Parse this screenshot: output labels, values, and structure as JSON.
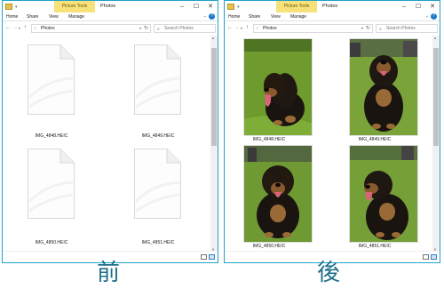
{
  "windows": {
    "left": {
      "title": "Photos",
      "context_tab": "Picture Tools",
      "ribbon_tabs": [
        "Home",
        "Share",
        "View",
        "Manage"
      ],
      "breadcrumb": "Photos",
      "search_placeholder": "Search Photos",
      "files": [
        {
          "name": "IMG_4848.HEIC"
        },
        {
          "name": "IMG_4849.HEIC"
        },
        {
          "name": "IMG_4850.HEIC"
        },
        {
          "name": "IMG_4851.HEIC"
        }
      ]
    },
    "right": {
      "title": "Photos",
      "context_tab": "Picture Tools",
      "ribbon_tabs": [
        "Home",
        "Share",
        "View",
        "Manage"
      ],
      "breadcrumb": "Photos",
      "search_placeholder": "Search Photos",
      "files": [
        {
          "name": "IMG_4848.HEIC"
        },
        {
          "name": "IMG_4849.HEIC"
        },
        {
          "name": "IMG_4850.HEIC"
        },
        {
          "name": "IMG_4851.HEIC"
        }
      ]
    }
  },
  "captions": {
    "before": "前",
    "after": "後"
  },
  "icons": {
    "back": "back-arrow-icon",
    "forward": "forward-arrow-icon",
    "up": "up-arrow-icon",
    "refresh": "refresh-icon",
    "search": "search-icon",
    "minimize": "minimize-icon",
    "maximize": "maximize-icon",
    "close": "close-icon",
    "help": "help-icon"
  },
  "colors": {
    "accent": "#1fa2c9",
    "context_tab": "#f7e17a",
    "caption": "#1f6f8b"
  }
}
